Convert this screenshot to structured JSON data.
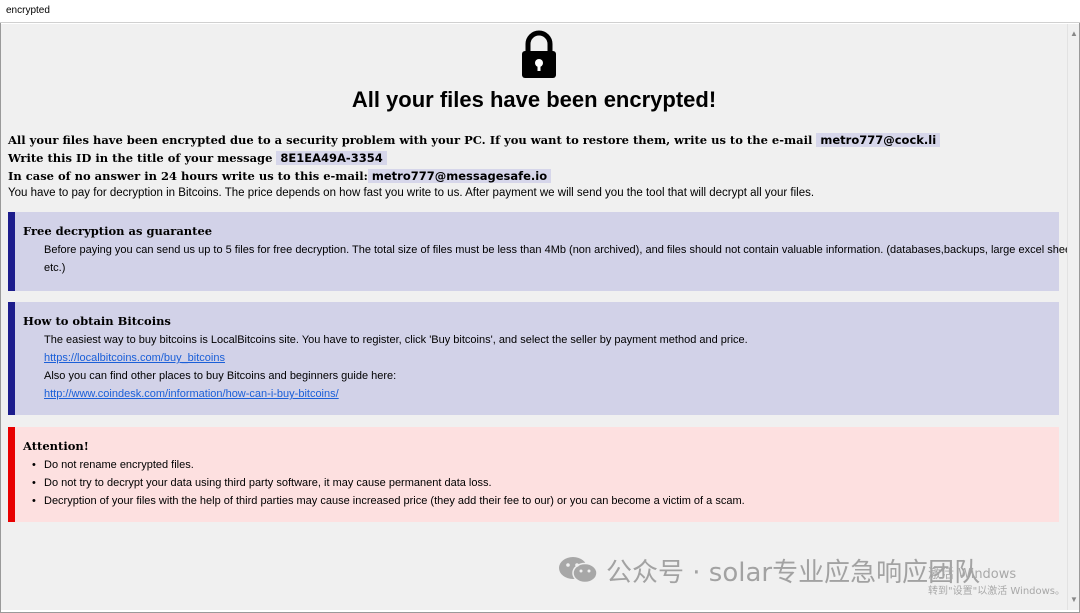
{
  "window": {
    "title": "encrypted"
  },
  "heading": "All your files have been encrypted!",
  "intro": {
    "line1_text": "All your files have been encrypted due to a security problem with your PC. If you want to restore them, write us to the e-mail",
    "line1_email": "metro777@cock.li",
    "line2_text": "Write this ID in the title of your message",
    "line2_id": "8E1EA49A-3354",
    "line3_text": "In case of no answer in 24 hours write us to this e-mail:",
    "line3_email": "metro777@messagesafe.io",
    "line4_text": "You have to pay for decryption in Bitcoins. The price depends on how fast you write to us. After payment we will send you the tool that will decrypt all your files."
  },
  "free_decryption": {
    "title": "Free decryption as guarantee",
    "text_line1": "Before paying you can send us up to 5 files for free decryption. The total size of files must be less than 4Mb (non archived), and files should not contain valuable information. (databases,backups, large excel sheets,",
    "text_line2": "etc.)"
  },
  "obtain_bitcoins": {
    "title": "How to obtain Bitcoins",
    "text1": "The easiest way to buy bitcoins is LocalBitcoins site. You have to register, click 'Buy bitcoins', and select the seller by payment method and price.",
    "link1": "https://localbitcoins.com/buy_bitcoins",
    "text2": "Also you can find other places to buy Bitcoins and beginners guide here:",
    "link2": "http://www.coindesk.com/information/how-can-i-buy-bitcoins/"
  },
  "attention": {
    "title": "Attention!",
    "items": [
      "Do not rename encrypted files.",
      "Do not try to decrypt your data using third party software, it may cause permanent data loss.",
      "Decryption of your files with the help of third parties may cause increased price (they add their fee to our) or you can become a victim of a scam."
    ]
  },
  "watermark": {
    "text": "公众号 · solar专业应急响应团队",
    "activate_line1": "激活 Windows",
    "activate_line2": "转到\"设置\"以激活 Windows。"
  },
  "colors": {
    "blue_block": "#d2d2e8",
    "blue_bar": "#1c1c8c",
    "red_block": "#fde0e0",
    "red_bar": "#e80000",
    "link": "#1a5fd8"
  }
}
